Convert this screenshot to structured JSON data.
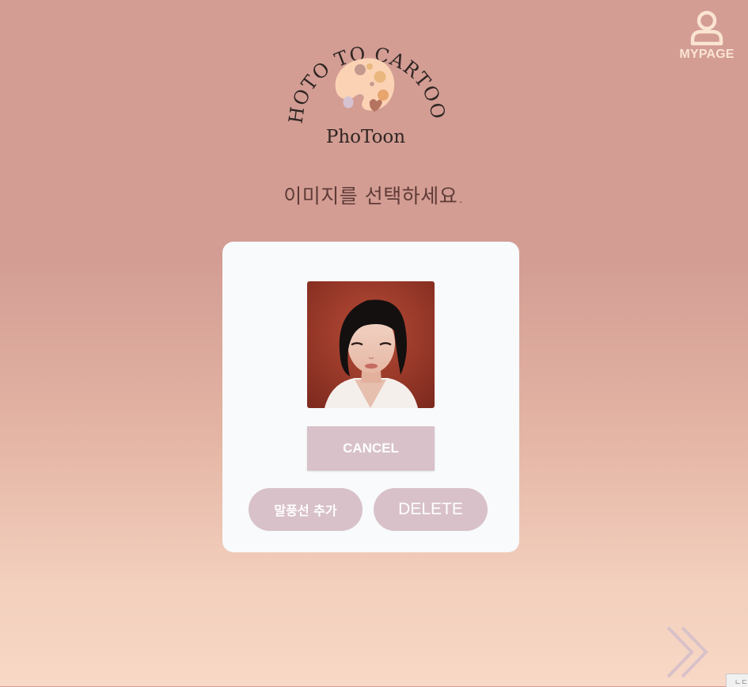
{
  "header": {
    "mypage_label": "MYPAGE",
    "mypage_icon": "user-icon"
  },
  "logo": {
    "arc_text": "PHOTO TO CARTOON",
    "wordmark": "PhoToon",
    "icon": "palette-icon"
  },
  "main": {
    "prompt": "이미지를 선택하세요."
  },
  "card": {
    "cancel_label": "CANCEL",
    "add_bubble_label": "말풍선 추가",
    "delete_label": "DELETE"
  },
  "footer": {
    "next_icon": "double-chevron-right-icon",
    "corner_text": "ㄴㄷ"
  },
  "colors": {
    "background_top": "#d39d94",
    "background_bottom": "#f8d8c6",
    "card": "#f8fafc",
    "button": "#d8c1c8",
    "accent_cream": "#fae4d2"
  }
}
